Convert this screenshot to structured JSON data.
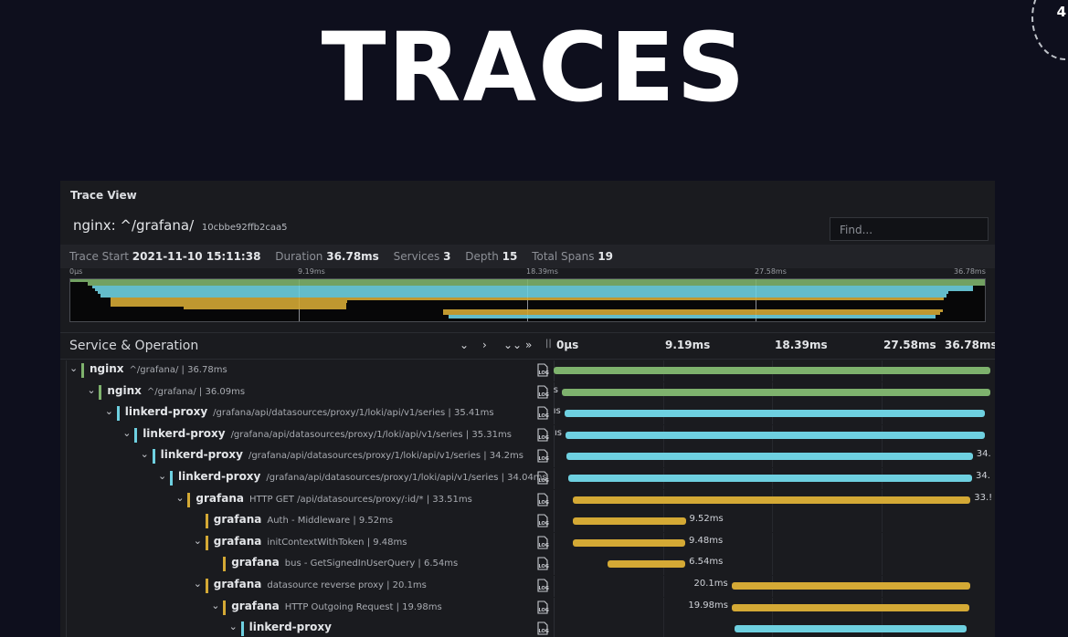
{
  "hero_title": "TRACES",
  "corner_number": "4",
  "panel": {
    "title": "Trace View",
    "trace_name": "nginx: ^/grafana/",
    "trace_id": "10cbbe92ffb2caa5",
    "find_placeholder": "Find...",
    "meta": {
      "start_label": "Trace Start",
      "start_value": "2021-11-10 15:11:38",
      "duration_label": "Duration",
      "duration_value": "36.78ms",
      "services_label": "Services",
      "services_value": "3",
      "depth_label": "Depth",
      "depth_value": "15",
      "spans_label": "Total Spans",
      "spans_value": "19"
    },
    "minimap_ticks": [
      "0µs",
      "9.19ms",
      "18.39ms",
      "27.58ms",
      "36.78ms"
    ],
    "header": {
      "title": "Service & Operation",
      "controls": [
        "⌄",
        "›",
        "⌄⌄",
        "»"
      ],
      "divider": "||"
    },
    "timeline_ticks": [
      "0µs",
      "9.19ms",
      "18.39ms",
      "27.58ms",
      "36.78ms"
    ]
  },
  "colors": {
    "nginx": "#7eb26d",
    "linkerd-proxy": "#6ed0e0",
    "grafana": "#d4a935"
  },
  "total_ms": 36.78,
  "spans": [
    {
      "depth": 0,
      "service": "nginx",
      "op": "^/grafana/ | 36.78ms",
      "start": 0.0,
      "dur": 36.78,
      "label": "",
      "label_pos": "none"
    },
    {
      "depth": 1,
      "service": "nginx",
      "op": "^/grafana/ | 36.09ms",
      "start": 0.69,
      "dur": 36.09,
      "label": "s",
      "label_pos": "left"
    },
    {
      "depth": 2,
      "service": "linkerd-proxy",
      "op": "/grafana/api/datasources/proxy/1/loki/api/v1/series | 35.41ms",
      "start": 0.9,
      "dur": 35.41,
      "label": "ıs",
      "label_pos": "left"
    },
    {
      "depth": 3,
      "service": "linkerd-proxy",
      "op": "/grafana/api/datasources/proxy/1/loki/api/v1/series | 35.31ms",
      "start": 1.0,
      "dur": 35.31,
      "label": "ıs",
      "label_pos": "left"
    },
    {
      "depth": 4,
      "service": "linkerd-proxy",
      "op": "/grafana/api/datasources/proxy/1/loki/api/v1/series | 34.2ms",
      "start": 1.1,
      "dur": 34.2,
      "label": "34.",
      "label_pos": "right"
    },
    {
      "depth": 5,
      "service": "linkerd-proxy",
      "op": "/grafana/api/datasources/proxy/1/loki/api/v1/series | 34.04ms",
      "start": 1.2,
      "dur": 34.04,
      "label": "34.",
      "label_pos": "right"
    },
    {
      "depth": 6,
      "service": "grafana",
      "op": "HTTP GET /api/datasources/proxy/:id/* | 33.51ms",
      "start": 1.6,
      "dur": 33.51,
      "label": "33.!",
      "label_pos": "right"
    },
    {
      "depth": 7,
      "service": "grafana",
      "op": "Auth - Middleware | 9.52ms",
      "start": 1.6,
      "dur": 9.52,
      "label": "9.52ms",
      "label_pos": "right"
    },
    {
      "depth": 7,
      "service": "grafana",
      "op": "initContextWithToken | 9.48ms",
      "start": 1.6,
      "dur": 9.48,
      "label": "9.48ms",
      "label_pos": "right"
    },
    {
      "depth": 8,
      "service": "grafana",
      "op": "bus - GetSignedInUserQuery | 6.54ms",
      "start": 4.55,
      "dur": 6.54,
      "label": "6.54ms",
      "label_pos": "right"
    },
    {
      "depth": 7,
      "service": "grafana",
      "op": "datasource reverse proxy | 20.1ms",
      "start": 14.98,
      "dur": 20.1,
      "label": "20.1ms",
      "label_pos": "left"
    },
    {
      "depth": 8,
      "service": "grafana",
      "op": "HTTP Outgoing Request | 19.98ms",
      "start": 15.0,
      "dur": 19.98,
      "label": "19.98ms",
      "label_pos": "left"
    },
    {
      "depth": 9,
      "service": "linkerd-proxy",
      "op": "",
      "start": 15.2,
      "dur": 19.6,
      "label": "",
      "label_pos": "none"
    }
  ]
}
